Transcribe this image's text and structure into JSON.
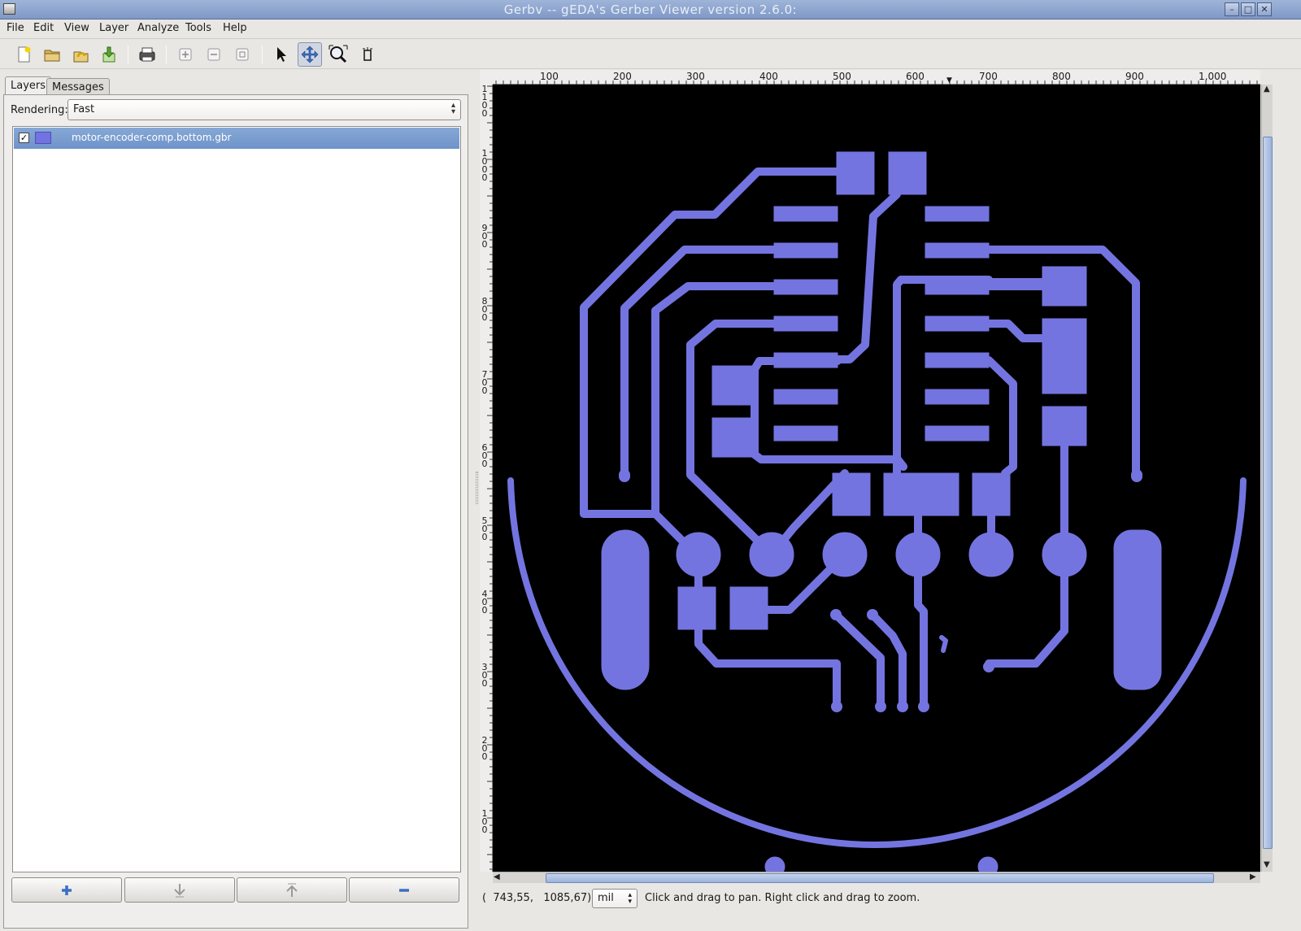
{
  "window": {
    "title": "Gerbv -- gEDA's Gerber Viewer version 2.6.0:"
  },
  "menu": [
    "File",
    "Edit",
    "View",
    "Layer",
    "Analyze",
    "Tools",
    "Help"
  ],
  "tabs": {
    "layers": "Layers",
    "messages": "Messages"
  },
  "rendering": {
    "label": "Rendering:",
    "value": "Fast"
  },
  "layers": [
    {
      "name": "motor-encoder-comp.bottom.gbr",
      "visible": true,
      "color": "#7474e0"
    }
  ],
  "ruler": {
    "horizontal": [
      "100",
      "200",
      "300",
      "400",
      "500",
      "600",
      "700",
      "800",
      "900",
      "1,000"
    ],
    "vertical": [
      "1\n1\n0\n0",
      "1\n0\n0\n0",
      "9\n0\n0",
      "8\n0\n0",
      "7\n0\n0",
      "6\n0\n0",
      "5\n0\n0",
      "4\n0\n0",
      "3\n0\n0",
      "2\n0\n0",
      "1\n0\n0"
    ]
  },
  "status": {
    "coords": "(  743,55,   1085,67)",
    "unit": "mil",
    "hint": "Click and drag to pan. Right click and drag to zoom."
  },
  "colors": {
    "trace": "#7474e0",
    "background": "#000000"
  }
}
